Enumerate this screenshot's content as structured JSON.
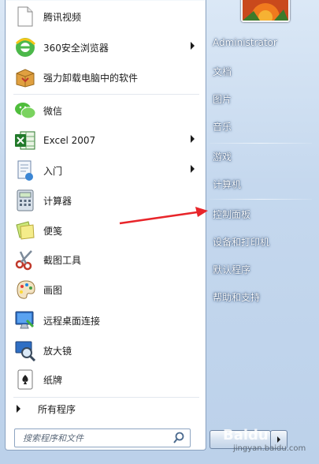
{
  "left_panel": {
    "items": [
      {
        "label": "腾讯视频",
        "icon": "document-icon",
        "has_submenu": false
      },
      {
        "label": "360安全浏览器",
        "icon": "browser-icon",
        "has_submenu": true
      },
      {
        "label": "强力卸载电脑中的软件",
        "icon": "uninstall-box-icon",
        "has_submenu": false
      },
      {
        "label": "微信",
        "icon": "wechat-icon",
        "has_submenu": false
      },
      {
        "label": "Excel 2007",
        "icon": "excel-icon",
        "has_submenu": true
      },
      {
        "label": "入门",
        "icon": "getting-started-icon",
        "has_submenu": true
      },
      {
        "label": "计算器",
        "icon": "calculator-icon",
        "has_submenu": false
      },
      {
        "label": "便笺",
        "icon": "sticky-notes-icon",
        "has_submenu": false
      },
      {
        "label": "截图工具",
        "icon": "snipping-tool-icon",
        "has_submenu": false
      },
      {
        "label": "画图",
        "icon": "paint-icon",
        "has_submenu": false
      },
      {
        "label": "远程桌面连接",
        "icon": "remote-desktop-icon",
        "has_submenu": false
      },
      {
        "label": "放大镜",
        "icon": "magnifier-icon",
        "has_submenu": false
      },
      {
        "label": "纸牌",
        "icon": "solitaire-icon",
        "has_submenu": false
      }
    ],
    "all_programs": "所有程序"
  },
  "search": {
    "placeholder": "搜索程序和文件"
  },
  "right_panel": {
    "items": [
      {
        "label": "Administrator"
      },
      {
        "label": "文档"
      },
      {
        "label": "图片"
      },
      {
        "label": "音乐"
      },
      {
        "label": "游戏"
      },
      {
        "label": "计算机"
      },
      {
        "label": "控制面板"
      },
      {
        "label": "设备和打印机"
      },
      {
        "label": "默认程序"
      },
      {
        "label": "帮助和支持"
      }
    ]
  },
  "watermark": {
    "brand": "Baidu",
    "site": "jingyan.baidu.com"
  },
  "colors": {
    "accent_red": "#e8252a",
    "panel_blue": "#c5d8ee",
    "border": "#8ea5c2"
  }
}
